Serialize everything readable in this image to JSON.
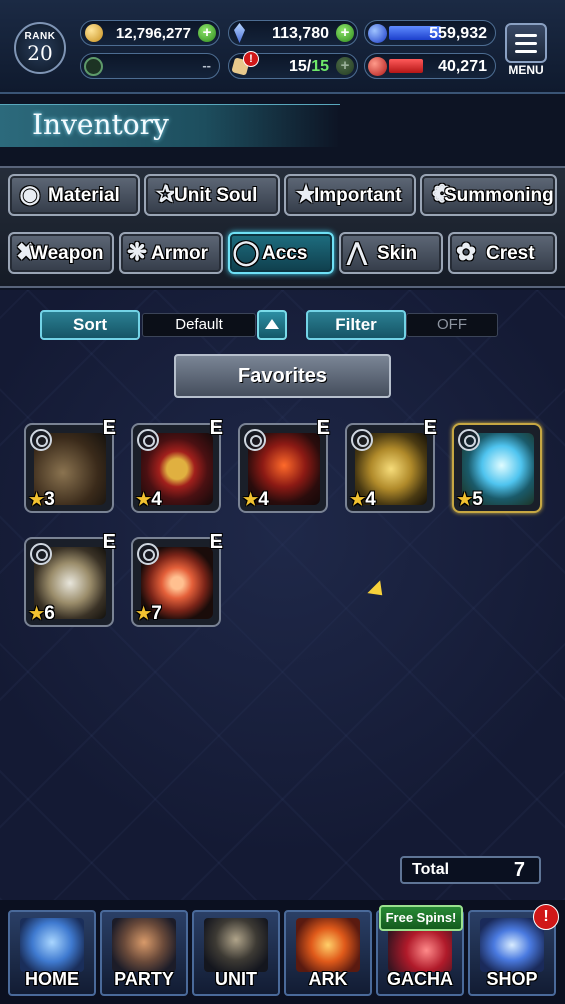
{
  "header": {
    "rank_label": "RANK",
    "rank_value": "20",
    "gil": "12,796,277",
    "lapis": "113,780",
    "blue_orb": "559,932",
    "green_slot": "--",
    "stamina": "15",
    "stamina_sep": "/",
    "stamina_max": "15",
    "red_orb": "40,271",
    "menu_label": "MENU",
    "stamina_alert": "!"
  },
  "title": "Inventory",
  "tabs_row1": [
    {
      "label": "Material",
      "icon": "bag-icon"
    },
    {
      "label": "Unit Soul",
      "icon": "soul-icon"
    },
    {
      "label": "Important",
      "icon": "star-icon"
    },
    {
      "label": "Summoning",
      "icon": "summon-icon"
    }
  ],
  "tabs_row2": [
    {
      "label": "Weapon",
      "icon": "sword-icon"
    },
    {
      "label": "Armor",
      "icon": "armor-icon"
    },
    {
      "label": "Accs",
      "icon": "ring-icon",
      "active": true
    },
    {
      "label": "Skin",
      "icon": "hanger-icon"
    },
    {
      "label": "Crest",
      "icon": "crest-icon"
    }
  ],
  "controls": {
    "sort_label": "Sort",
    "sort_value": "Default",
    "filter_label": "Filter",
    "filter_value": "OFF",
    "favorites_label": "Favorites"
  },
  "items": [
    {
      "stars": "3",
      "equipped": "E"
    },
    {
      "stars": "4",
      "equipped": "E"
    },
    {
      "stars": "4",
      "equipped": "E"
    },
    {
      "stars": "4",
      "equipped": "E"
    },
    {
      "stars": "5",
      "equipped": ""
    },
    {
      "stars": "6",
      "equipped": "E"
    },
    {
      "stars": "7",
      "equipped": "E"
    }
  ],
  "total": {
    "label": "Total",
    "value": "7"
  },
  "nav": {
    "home": "HOME",
    "party": "PARTY",
    "unit": "UNIT",
    "ark": "ARK",
    "gacha": "GACHA",
    "shop": "SHOP",
    "free_spins": "Free Spins!",
    "shop_alert": "!"
  },
  "colors": {
    "accent": "#6fe0f5",
    "star": "#f2c230",
    "alert": "#d01818"
  }
}
